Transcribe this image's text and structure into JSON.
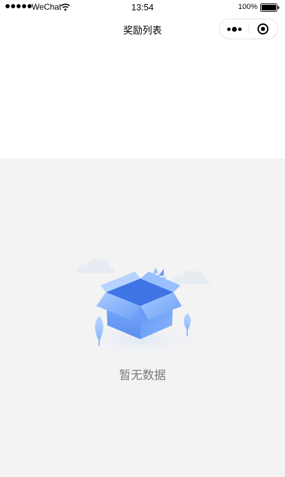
{
  "status_bar": {
    "carrier": "WeChat",
    "time": "13:54",
    "battery": "100%"
  },
  "nav": {
    "title": "奖励列表",
    "more_icon": "more-dots-icon",
    "close_icon": "target-close-icon"
  },
  "empty_state": {
    "illustration": "empty-box-illustration",
    "text": "暂无数据"
  },
  "colors": {
    "page_background": "#f3f3f3",
    "header_background": "#ffffff",
    "box_blue": "#5b8ef0",
    "empty_text": "#7a7a7a"
  }
}
